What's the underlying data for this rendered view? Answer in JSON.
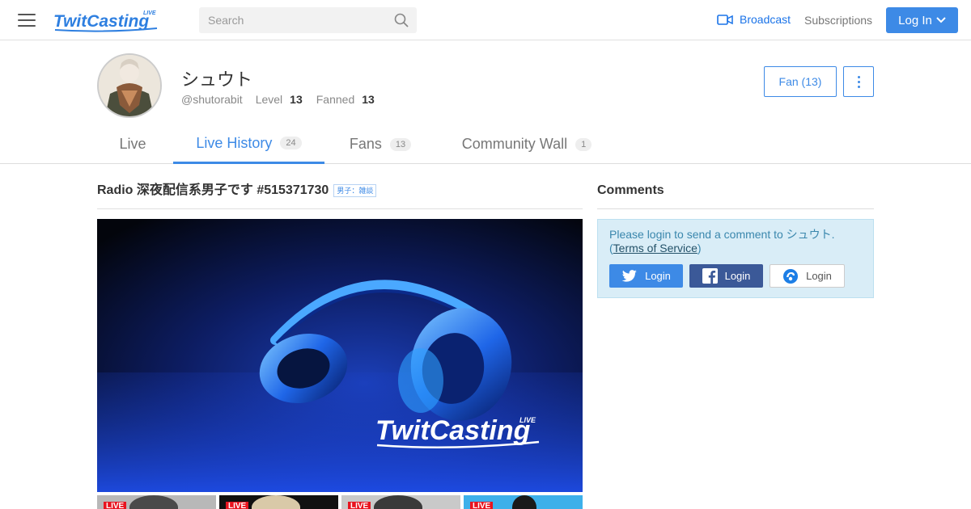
{
  "header": {
    "logo_text": "TwitCasting",
    "logo_live": "LIVE",
    "search_placeholder": "Search",
    "broadcast_label": "Broadcast",
    "subscriptions_label": "Subscriptions",
    "login_label": "Log In"
  },
  "profile": {
    "name": "シュウト",
    "handle": "@shutorabit",
    "level_label": "Level",
    "level_value": "13",
    "fanned_label": "Fanned",
    "fanned_value": "13",
    "fan_button_label": "Fan (13)"
  },
  "tabs": [
    {
      "label": "Live",
      "count": ""
    },
    {
      "label": "Live History",
      "count": "24"
    },
    {
      "label": "Fans",
      "count": "13"
    },
    {
      "label": "Community Wall",
      "count": "1"
    }
  ],
  "stream": {
    "title": "Radio 深夜配信系男子です #515371730",
    "category": "男子：雑談"
  },
  "player": {
    "watermark": "TwitCasting",
    "watermark_live": "LIVE"
  },
  "thumbnails": [
    {
      "tag": "LIVE"
    },
    {
      "tag": "LIVE"
    },
    {
      "tag": "LIVE"
    },
    {
      "tag": "LIVE"
    }
  ],
  "comments": {
    "title": "Comments",
    "login_message": "Please login to send a comment to シュウト.",
    "terms_open": "(",
    "terms_link": "Terms of Service",
    "terms_close": ")",
    "twitter_login": "Login",
    "facebook_login": "Login",
    "twitcasting_login": "Login"
  },
  "colors": {
    "accent": "#3d8ae6",
    "twitter": "#3d8ae6",
    "facebook": "#3b5998",
    "live_red": "#e8141f",
    "info_bg": "#d9edf7"
  }
}
